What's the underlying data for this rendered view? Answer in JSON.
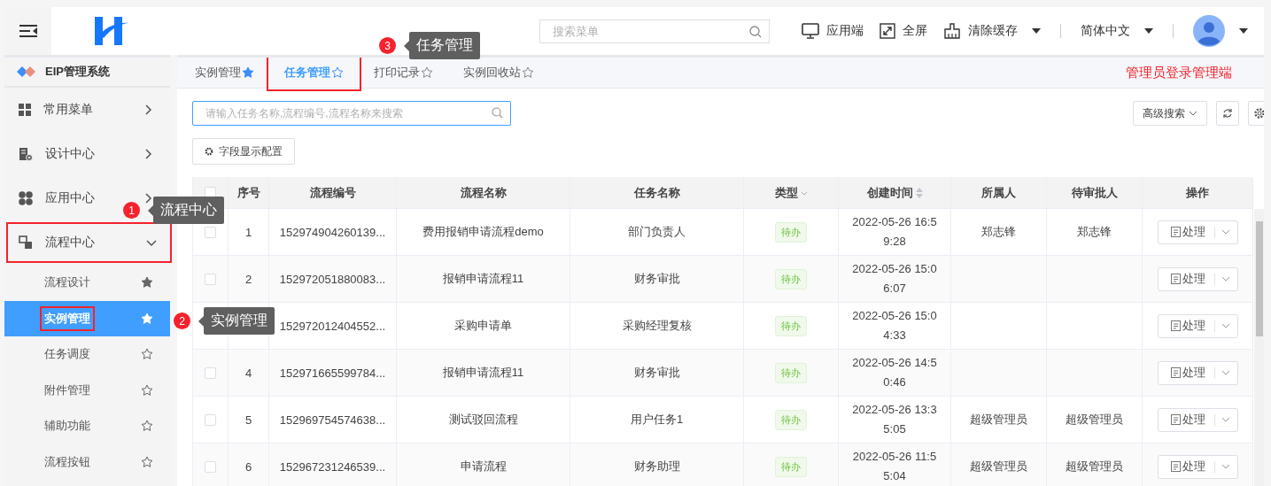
{
  "header": {
    "search": {
      "placeholder": "搜索菜单"
    },
    "actions": [
      {
        "kind": "monitor",
        "label": "应用端"
      },
      {
        "kind": "fullscreen",
        "label": "全屏"
      },
      {
        "kind": "cache",
        "label": "清除缓存",
        "dropdown": true
      }
    ],
    "language": "简体中文"
  },
  "sidebar": {
    "title": "EIP管理系统",
    "items": [
      {
        "kind": "grid",
        "label": "常用菜单",
        "expanded": false,
        "annotated": false
      },
      {
        "kind": "design",
        "label": "设计中心",
        "expanded": false,
        "annotated": false
      },
      {
        "kind": "apps",
        "label": "应用中心",
        "expanded": false,
        "annotated": false
      },
      {
        "kind": "flow",
        "label": "流程中心",
        "expanded": true,
        "annotated": true,
        "children": [
          {
            "label": "流程设计",
            "favorite": true,
            "selected": false,
            "annotated": false
          },
          {
            "label": "实例管理",
            "favorite": true,
            "selected": true,
            "annotated": true
          },
          {
            "label": "任务调度",
            "favorite": false,
            "selected": false,
            "annotated": false
          },
          {
            "label": "附件管理",
            "favorite": false,
            "selected": false,
            "annotated": false
          },
          {
            "label": "辅助功能",
            "favorite": false,
            "selected": false,
            "annotated": false
          },
          {
            "label": "流程按钮",
            "favorite": false,
            "selected": false,
            "annotated": false
          }
        ]
      }
    ]
  },
  "tabs": [
    {
      "label": "实例管理",
      "favorite": true,
      "selected": false,
      "annotated": false
    },
    {
      "label": "任务管理",
      "favorite": false,
      "selected": true,
      "annotated": true
    },
    {
      "label": "打印记录",
      "favorite": false,
      "selected": false,
      "annotated": false
    },
    {
      "label": "实例回收站",
      "favorite": false,
      "selected": false,
      "annotated": false
    }
  ],
  "notice": "管理员登录管理端",
  "toolbar": {
    "search": {
      "placeholder": "请输入任务名称,流程编号,流程名称来搜索"
    },
    "advanced_search": "高级搜索",
    "field_config": "字段显示配置"
  },
  "table": {
    "columns": [
      {
        "kind": "check",
        "checked": false
      },
      {
        "label": "序号",
        "kind": "plain"
      },
      {
        "label": "流程编号",
        "kind": "plain"
      },
      {
        "label": "流程名称",
        "kind": "plain"
      },
      {
        "label": "任务名称",
        "kind": "plain"
      },
      {
        "label": "类型",
        "kind": "filter"
      },
      {
        "label": "创建时间",
        "kind": "sort"
      },
      {
        "label": "所属人",
        "kind": "plain"
      },
      {
        "label": "待审批人",
        "kind": "plain"
      },
      {
        "label": "操作",
        "kind": "plain"
      }
    ],
    "rows": [
      {
        "checked": false,
        "index": "1",
        "flow_no": "152974904260139...",
        "flow_name": "费用报销申请流程demo",
        "task_name": "部门负责人",
        "type": "待办",
        "created": "2022-05-26 16:59:28",
        "owner": "郑志锋",
        "approver": "郑志锋",
        "action": "处理"
      },
      {
        "checked": false,
        "index": "2",
        "flow_no": "152972051880083...",
        "flow_name": "报销申请流程11",
        "task_name": "财务审批",
        "type": "待办",
        "created": "2022-05-26 15:06:07",
        "owner": "",
        "approver": "",
        "action": "处理"
      },
      {
        "flow_no": "152972012404552...",
        "flow_name": "采购申请单",
        "task_name": "采购经理复核",
        "type": "待办",
        "created": "2022-05-26 15:04:33",
        "owner": "",
        "approver": "",
        "action": "处理"
      },
      {
        "checked": false,
        "index": "4",
        "flow_no": "152971665599784...",
        "flow_name": "报销申请流程11",
        "task_name": "财务审批",
        "type": "待办",
        "created": "2022-05-26 14:50:46",
        "owner": "",
        "approver": "",
        "action": "处理"
      },
      {
        "checked": false,
        "index": "5",
        "flow_no": "152969754574638...",
        "flow_name": "测试驳回流程",
        "task_name": "用户任务1",
        "type": "待办",
        "created": "2022-05-26 13:35:05",
        "owner": "超级管理员",
        "approver": "超级管理员",
        "action": "处理"
      },
      {
        "checked": false,
        "index": "6",
        "flow_no": "152967231246539...",
        "flow_name": "申请流程",
        "task_name": "财务助理",
        "type": "待办",
        "created": "2022-05-26 11:55:04",
        "owner": "超级管理员",
        "approver": "超级管理员",
        "action": "处理"
      }
    ]
  },
  "callouts": [
    {
      "number": "1",
      "label": "流程中心"
    },
    {
      "number": "2",
      "label": "实例管理"
    },
    {
      "number": "3",
      "label": "任务管理"
    }
  ]
}
